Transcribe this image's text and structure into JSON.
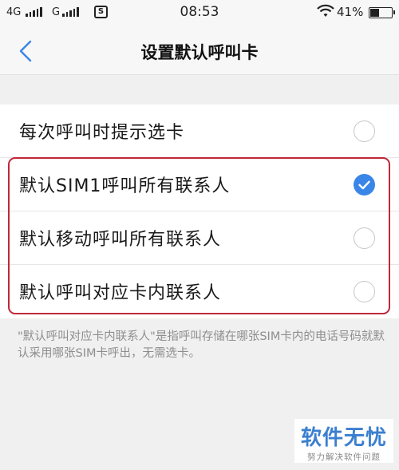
{
  "status_bar": {
    "network1": "4G",
    "network2": "G",
    "sim_badge": "S",
    "time": "08:53",
    "battery_text": "41%",
    "battery_level": 0.41
  },
  "nav": {
    "back_icon": "chevron-left-icon",
    "title": "设置默认呼叫卡"
  },
  "options": [
    {
      "label": "每次呼叫时提示选卡",
      "selected": false
    },
    {
      "label": "默认SIM1呼叫所有联系人",
      "selected": true
    },
    {
      "label": "默认移动呼叫所有联系人",
      "selected": false
    },
    {
      "label": "默认呼叫对应卡内联系人",
      "selected": false
    }
  ],
  "footnote": "\"默认呼叫对应卡内联系人\"是指呼叫存储在哪张SIM卡内的电话号码就默认采用哪张SIM卡呼出，无需选卡。",
  "watermark": {
    "title": "软件无忧",
    "subtitle": "努力解决软件问题"
  },
  "colors": {
    "accent": "#3a86e8",
    "highlight_border": "#c0273a",
    "watermark": "#3b7fd0"
  }
}
